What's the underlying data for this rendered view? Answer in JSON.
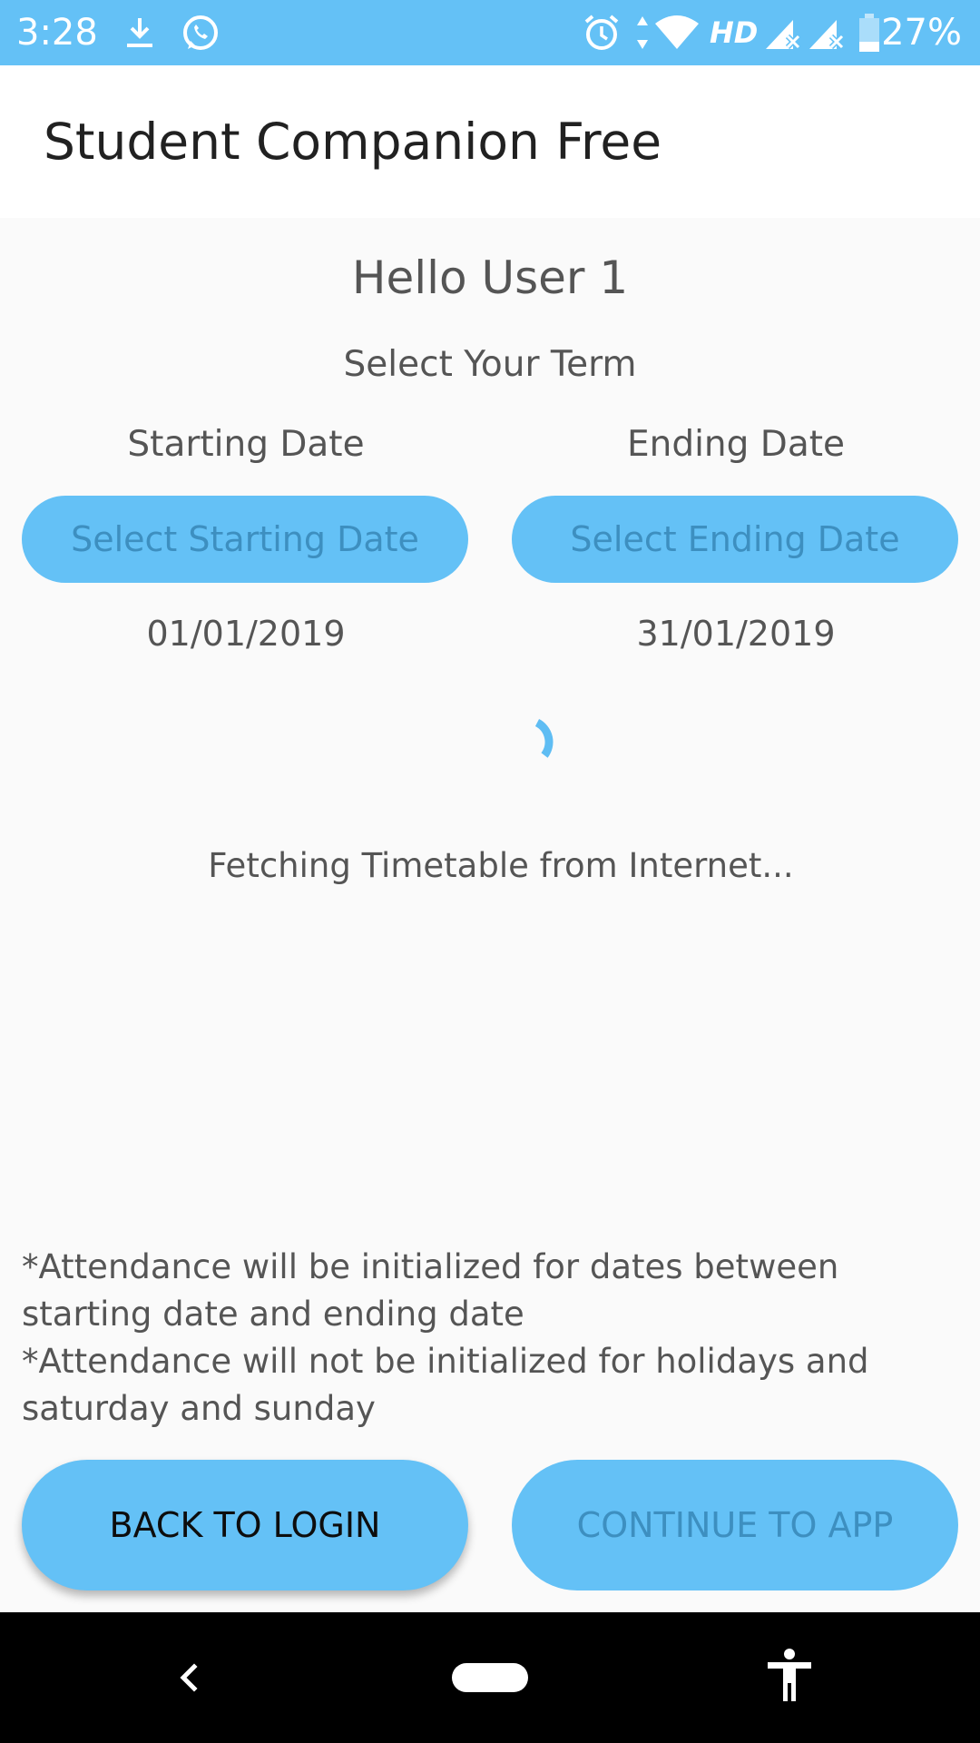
{
  "status_bar": {
    "time": "3:28",
    "battery": "27%",
    "network_label": "HD",
    "icons": [
      "download-icon",
      "whatsapp-icon",
      "alarm-icon",
      "data-arrows-icon",
      "wifi-icon",
      "hd-icon",
      "signal-icon",
      "signal-icon",
      "battery-icon"
    ]
  },
  "app_bar": {
    "title": "Student Companion Free"
  },
  "main": {
    "greeting": "Hello User 1",
    "term_label": "Select Your Term",
    "start": {
      "label": "Starting Date",
      "button": "Select Starting Date",
      "value": "01/01/2019"
    },
    "end": {
      "label": "Ending Date",
      "button": "Select Ending Date",
      "value": "31/01/2019"
    },
    "loading_text": "Fetching Timetable from Internet...",
    "notes": [
      "*Attendance will be initialized for dates between starting date and ending date",
      "*Attendance will not be initialized for holidays and saturday and sunday"
    ]
  },
  "actions": {
    "back": "BACK TO LOGIN",
    "continue": "CONTINUE TO APP"
  },
  "navigation": {
    "icons": [
      "back-icon",
      "home-icon",
      "accessibility-icon"
    ]
  },
  "colors": {
    "accent": "#64c1f6",
    "disabled_text": "#3d8fc0",
    "background": "#fafafa"
  }
}
